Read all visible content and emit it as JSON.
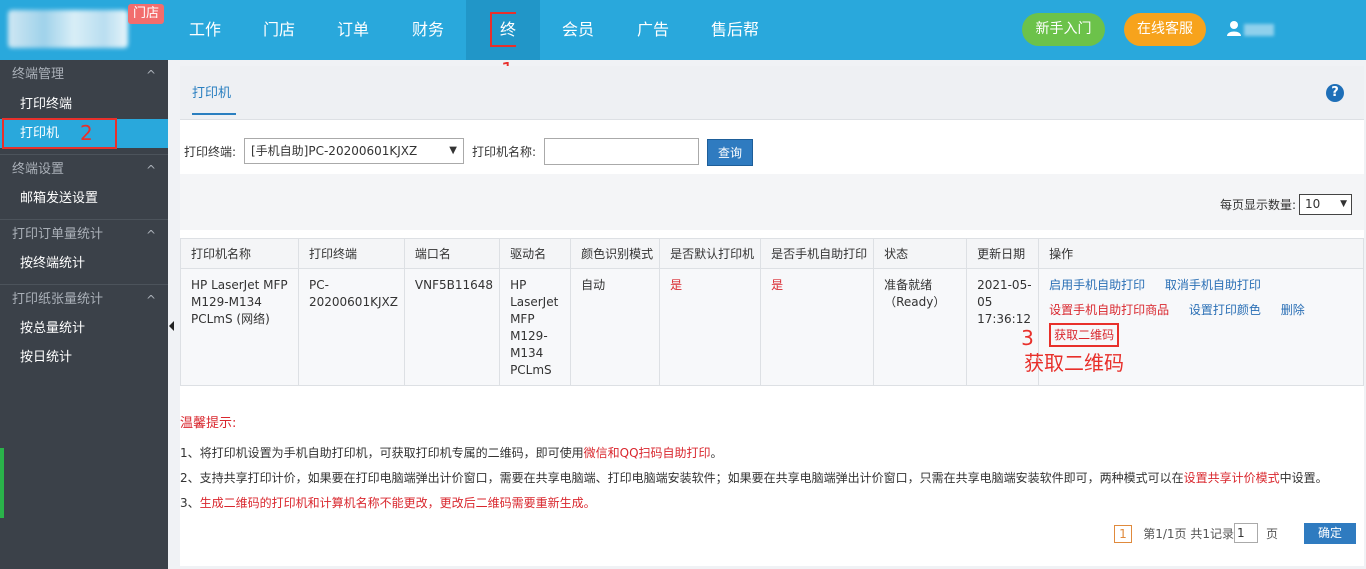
{
  "header": {
    "store_badge": "门店",
    "nav": [
      {
        "label": "工作台"
      },
      {
        "label": "门店"
      },
      {
        "label": "订单"
      },
      {
        "label": "财务"
      },
      {
        "label": "终端"
      },
      {
        "label": "会员"
      },
      {
        "label": "广告"
      },
      {
        "label": "售后帮助"
      }
    ],
    "guide_btn": "新手入门",
    "service_btn": "在线客服"
  },
  "annotations": {
    "n1": "1",
    "n2": "2",
    "n3": "3",
    "qr_hint": "获取二维码"
  },
  "sidebar": {
    "groups": [
      {
        "title": "终端管理",
        "items": [
          "打印终端",
          "打印机"
        ]
      },
      {
        "title": "终端设置",
        "items": [
          "邮箱发送设置"
        ]
      },
      {
        "title": "打印订单量统计",
        "items": [
          "按终端统计"
        ]
      },
      {
        "title": "打印纸张量统计",
        "items": [
          "按总量统计",
          "按日统计"
        ]
      }
    ]
  },
  "main": {
    "tab": "打印机",
    "filter": {
      "terminal_label": "打印终端:",
      "terminal_value": "[手机自助]PC-20200601KJXZ",
      "printer_name_label": "打印机名称:",
      "printer_name_value": "",
      "query_btn": "查询"
    },
    "page_size_label": "每页显示数量:",
    "page_size_value": "10",
    "table": {
      "headers": [
        "打印机名称",
        "打印终端",
        "端口名",
        "驱动名",
        "颜色识别模式",
        "是否默认打印机",
        "是否手机自助打印",
        "状态",
        "更新日期",
        "操作"
      ],
      "row": {
        "name": "HP LaserJet MFP M129-M134 PCLmS (网络)",
        "terminal": "PC-20200601KJXZ",
        "port": "VNF5B11648",
        "driver": "HP LaserJet MFP M129-M134 PCLmS",
        "color_mode": "自动",
        "is_default": "是",
        "is_mobile": "是",
        "status": "准备就绪 （Ready）",
        "updated": "2021-05-05 17:36:12",
        "ops": {
          "enable": "启用手机自助打印",
          "cancel": "取消手机自助打印",
          "set_goods": "设置手机自助打印商品",
          "set_color": "设置打印颜色",
          "delete": "删除",
          "get_qr": "获取二维码"
        }
      }
    },
    "tips": {
      "title": "温馨提示:",
      "t1_a": "1、将打印机设置为手机自助打印机，可获取打印机专属的二维码，即可使用",
      "t1_b": "微信和QQ扫码自助打印",
      "t1_c": "。",
      "t2_a": "2、支持共享打印计价，如果要在打印电脑端弹出计价窗口，需要在共享电脑端、打印电脑端安装软件；如果要在共享电脑端弹出计价窗口，只需在共享电脑端安装软件即可，两种模式可以在",
      "t2_b": "设置共享计价模式",
      "t2_c": "中设置。",
      "t3_a": "3、",
      "t3_b": "生成二维码的打印机和计算机名称不能更改，更改后二维码需要重新生成。"
    },
    "pager": {
      "current": "1",
      "summary": "第1/1页 共1记录",
      "goto_value": "1",
      "unit": "页",
      "confirm": "确定"
    }
  }
}
